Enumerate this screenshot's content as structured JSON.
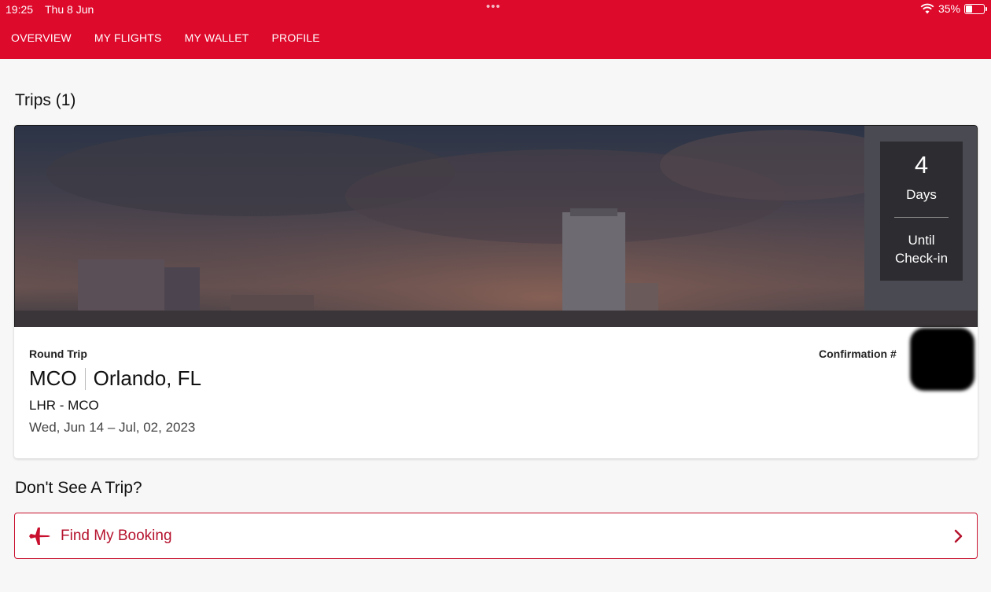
{
  "status": {
    "time": "19:25",
    "date": "Thu 8 Jun",
    "battery_percent": "35%",
    "battery_level": 0.35
  },
  "nav": {
    "items": [
      {
        "label": "OVERVIEW"
      },
      {
        "label": "MY FLIGHTS"
      },
      {
        "label": "MY WALLET"
      },
      {
        "label": "PROFILE"
      }
    ]
  },
  "trips": {
    "title": "Trips (1)",
    "card": {
      "countdown_number": "4",
      "countdown_unit": "Days",
      "countdown_label_line1": "Until",
      "countdown_label_line2": "Check-in",
      "trip_type": "Round Trip",
      "destination_code": "MCO",
      "destination_city": "Orlando, FL",
      "legs": "LHR - MCO",
      "dates": "Wed, Jun 14 – Jul, 02, 2023",
      "confirmation_label": "Confirmation #"
    }
  },
  "missing_trip": {
    "title": "Don't See A Trip?",
    "find_booking_label": "Find My Booking"
  },
  "colors": {
    "brand_red": "#de0a2c",
    "accent_red": "#b5122d"
  },
  "icons": {
    "wifi": "wifi-icon",
    "battery": "battery-icon",
    "plane": "plane-icon",
    "chevron": "chevron-right-icon"
  }
}
